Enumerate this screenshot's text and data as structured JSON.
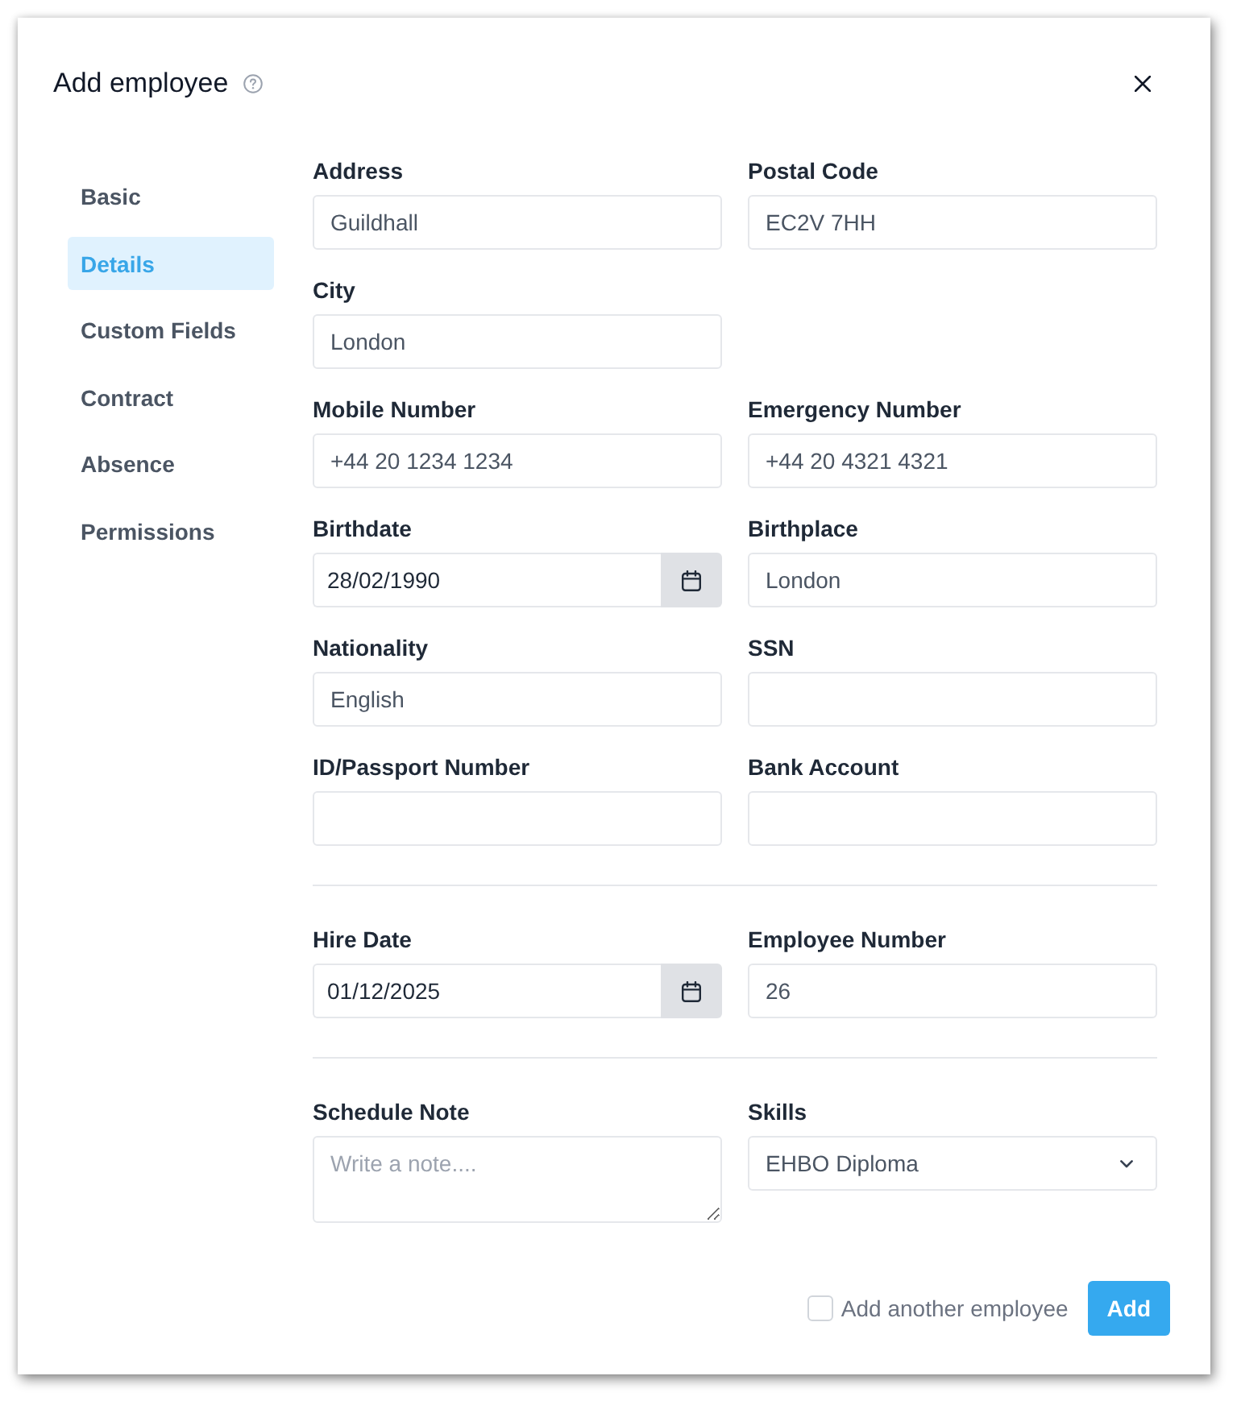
{
  "dialog": {
    "title": "Add employee"
  },
  "sidebar": {
    "items": [
      {
        "label": "Basic",
        "selected": false
      },
      {
        "label": "Details",
        "selected": true
      },
      {
        "label": "Custom Fields",
        "selected": false
      },
      {
        "label": "Contract",
        "selected": false
      },
      {
        "label": "Absence",
        "selected": false
      },
      {
        "label": "Permissions",
        "selected": false
      }
    ]
  },
  "sections": [
    {
      "rows": [
        [
          {
            "label": "Address",
            "kind": "text",
            "value": "Guildhall"
          },
          {
            "label": "Postal Code",
            "kind": "text",
            "value": "EC2V 7HH"
          }
        ],
        [
          {
            "label": "City",
            "kind": "text",
            "value": "London"
          }
        ],
        [
          {
            "label": "Mobile Number",
            "kind": "text",
            "value": "+44 20 1234 1234"
          },
          {
            "label": "Emergency Number",
            "kind": "text",
            "value": "+44 20 4321 4321"
          }
        ],
        [
          {
            "label": "Birthdate",
            "kind": "date",
            "value": "28/02/1990"
          },
          {
            "label": "Birthplace",
            "kind": "text",
            "value": "London"
          }
        ],
        [
          {
            "label": "Nationality",
            "kind": "text",
            "value": "English"
          },
          {
            "label": "SSN",
            "kind": "text"
          }
        ],
        [
          {
            "label": "ID/Passport Number",
            "kind": "text"
          },
          {
            "label": "Bank Account",
            "kind": "text"
          }
        ]
      ]
    },
    {
      "rows": [
        [
          {
            "label": "Hire Date",
            "kind": "date",
            "value": "01/12/2025"
          },
          {
            "label": "Employee Number",
            "kind": "text",
            "value": "26"
          }
        ]
      ]
    },
    {
      "rows": [
        [
          {
            "label": "Schedule Note",
            "kind": "textarea",
            "placeholder": "Write a note...."
          },
          {
            "label": "Skills",
            "kind": "select",
            "value": "EHBO Diploma"
          }
        ]
      ]
    }
  ],
  "footer": {
    "checkbox": {
      "label": "Add another employee",
      "checked": false
    },
    "buttons": [
      "Add"
    ]
  }
}
